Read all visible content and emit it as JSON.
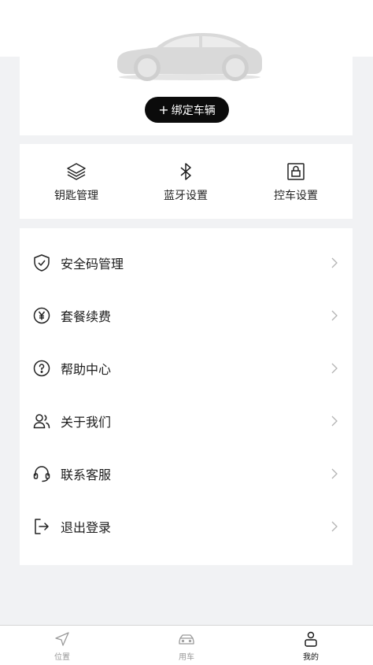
{
  "car": {
    "bind_label": "绑定车辆",
    "plus_glyph": "+"
  },
  "quick_actions": [
    {
      "label": "钥匙管理",
      "icon": "layers-icon"
    },
    {
      "label": "蓝牙设置",
      "icon": "bluetooth-icon"
    },
    {
      "label": "控车设置",
      "icon": "lock-icon"
    }
  ],
  "menu": [
    {
      "label": "安全码管理",
      "icon": "shield-check-icon"
    },
    {
      "label": "套餐续费",
      "icon": "yen-circle-icon"
    },
    {
      "label": "帮助中心",
      "icon": "question-circle-icon"
    },
    {
      "label": "关于我们",
      "icon": "users-icon"
    },
    {
      "label": "联系客服",
      "icon": "headset-icon"
    },
    {
      "label": "退出登录",
      "icon": "logout-icon"
    }
  ],
  "tabs": [
    {
      "label": "位置",
      "icon": "navigation-icon",
      "active": false
    },
    {
      "label": "用车",
      "icon": "car-icon",
      "active": false
    },
    {
      "label": "我的",
      "icon": "user-icon",
      "active": true
    }
  ],
  "colors": {
    "background": "#f1f2f4",
    "button": "#0b0b0b",
    "inactive": "#9a9a9a",
    "active": "#111111"
  }
}
